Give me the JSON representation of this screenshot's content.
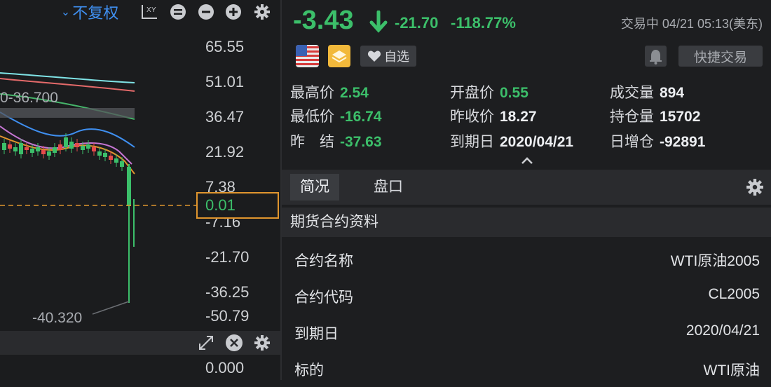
{
  "chart": {
    "adjust_label": "不复权",
    "price_ticks": [
      "65.55",
      "51.01",
      "36.47",
      "21.92",
      "7.38",
      "-7.16",
      "-21.70",
      "-36.25",
      "-50.79"
    ],
    "current_price": "0.01",
    "label_high": "0-36.700",
    "label_low": "-40.320",
    "indicator_tick": "0.000",
    "colors": {
      "up": "#e54b4b",
      "down": "#3cbf6a",
      "current_line": "#e0952e"
    }
  },
  "quote": {
    "last": "-3.43",
    "change": "-21.70",
    "change_pct": "-118.77%",
    "status_time": "交易中 04/21 05:13(美东)",
    "watch_label": "自选",
    "quick_trade_label": "快捷交易"
  },
  "stats": [
    {
      "label": "最高价",
      "value": "2.54",
      "color": "green"
    },
    {
      "label": "开盘价",
      "value": "0.55",
      "color": "green"
    },
    {
      "label": "成交量",
      "value": "894",
      "color": "white"
    },
    {
      "label": "最低价",
      "value": "-16.74",
      "color": "green"
    },
    {
      "label": "昨收价",
      "value": "18.27",
      "color": "white"
    },
    {
      "label": "持仓量",
      "value": "15702",
      "color": "white"
    },
    {
      "label": "昨　结",
      "value": "-37.63",
      "color": "green"
    },
    {
      "label": "到期日",
      "value": "2020/04/21",
      "color": "white"
    },
    {
      "label": "日增仓",
      "value": "-92891",
      "color": "white"
    }
  ],
  "tabs": {
    "overview": "简况",
    "orderbook": "盘口"
  },
  "section_title": "期货合约资料",
  "contract_info": [
    {
      "key": "合约名称",
      "value": "WTI原油2005"
    },
    {
      "key": "合约代码",
      "value": "CL2005"
    },
    {
      "key": "到期日",
      "value": "2020/04/21"
    },
    {
      "key": "标的",
      "value": "WTI原油"
    }
  ]
}
